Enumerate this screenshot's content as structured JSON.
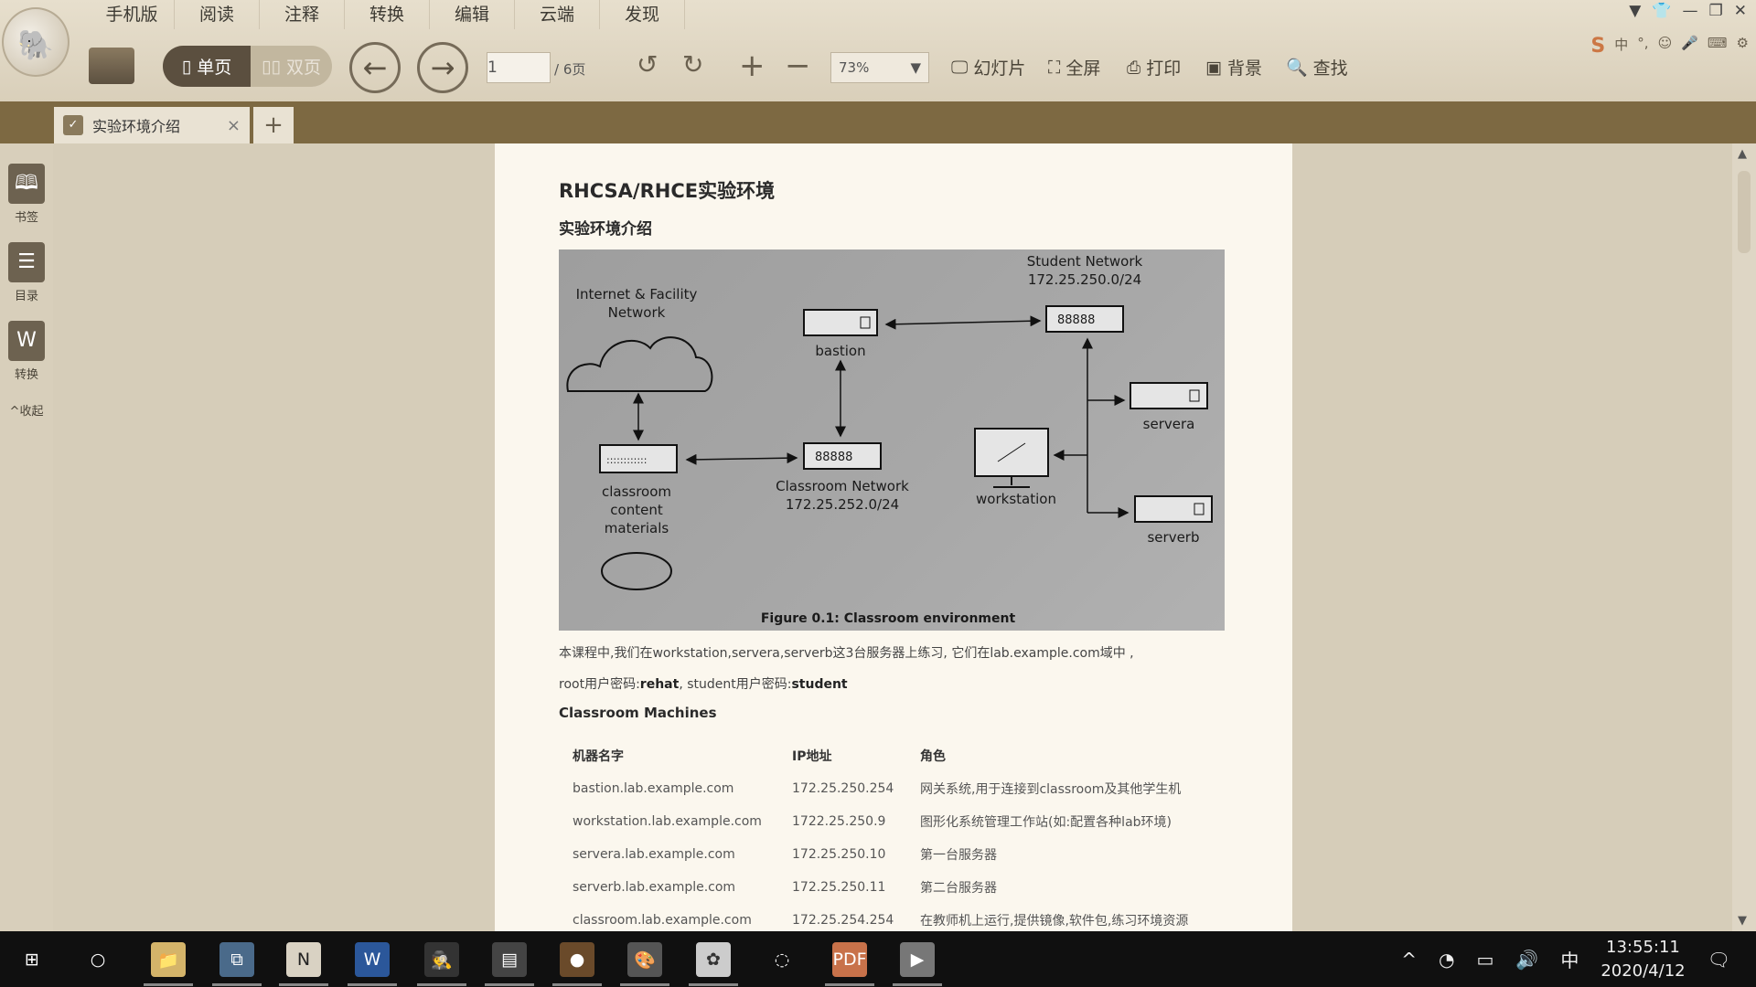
{
  "app": {
    "menu": [
      "手机版",
      "阅读",
      "注释",
      "转换",
      "编辑",
      "云端",
      "发现"
    ],
    "page_current": "1",
    "page_total": "/ 6页",
    "view_single": "单页",
    "view_double": "双页",
    "zoom": "73%",
    "tools": {
      "slideshow": "幻灯片",
      "fullscreen": "全屏",
      "print": "打印",
      "background": "背景",
      "find": "查找"
    },
    "tab_title": "实验环境介绍",
    "sidebar": {
      "bookmark": "书签",
      "toc": "目录",
      "convert": "转换",
      "collapse": "收起"
    }
  },
  "doc": {
    "title": "RHCSA/RHCE实验环境",
    "subtitle": "实验环境介绍",
    "figure": {
      "caption": "Figure 0.1: Classroom environment",
      "internet1": "Internet & Facility",
      "internet2": "Network",
      "bastion": "bastion",
      "student_net1": "Student Network",
      "student_net2": "172.25.250.0/24",
      "classroom_net1": "Classroom Network",
      "classroom_net2": "172.25.252.0/24",
      "content1": "classroom",
      "content2": "content",
      "content3": "materials",
      "servera": "servera",
      "serverb": "serverb",
      "workstation": "workstation"
    },
    "para1": "本课程中,我们在workstation,servera,serverb这3台服务器上练习, 它们在lab.example.com域中 ,",
    "para2_pre": "root用户密码:",
    "para2_pw1": "rehat",
    "para2_mid": ", student用户密码:",
    "para2_pw2": "student",
    "table_title": "Classroom Machines",
    "table": {
      "headers": [
        "机器名字",
        "IP地址",
        "角色"
      ],
      "rows": [
        [
          "bastion.lab.example.com",
          "172.25.250.254",
          "网关系统,用于连接到classroom及其他学生机"
        ],
        [
          "workstation.lab.example.com",
          "1722.25.250.9",
          "图形化系统管理工作站(如:配置各种lab环境)"
        ],
        [
          "servera.lab.example.com",
          "172.25.250.10",
          "第一台服务器"
        ],
        [
          "serverb.lab.example.com",
          "172.25.250.11",
          "第二台服务器"
        ],
        [
          "classroom.lab.example.com",
          "172.25.254.254",
          "在教师机上运行,提供镜像,软件包,练习环境资源"
        ]
      ]
    }
  },
  "taskbar": {
    "time": "13:55:11",
    "date": "2020/4/12",
    "ime": "中"
  }
}
